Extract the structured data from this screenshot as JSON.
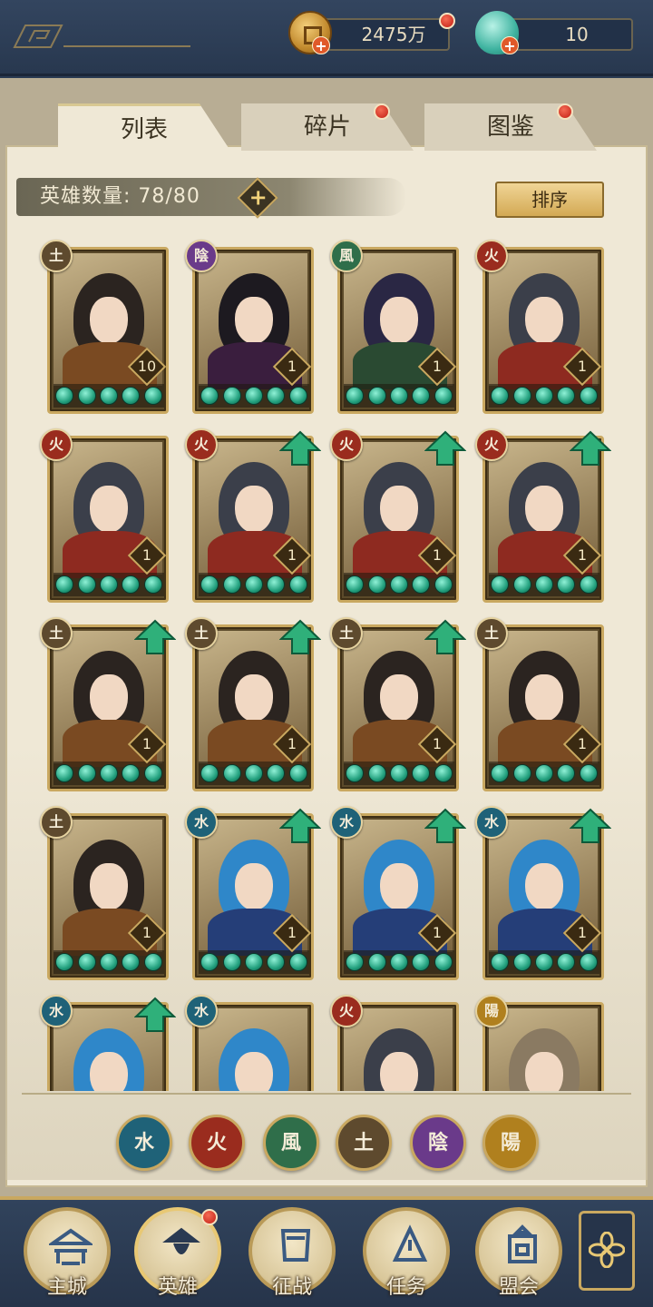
{
  "resources": {
    "coin_value": "2475万",
    "gem_value": "10"
  },
  "tabs": [
    {
      "label": "列表",
      "active": true
    },
    {
      "label": "碎片",
      "active": false
    },
    {
      "label": "图鉴",
      "active": false
    }
  ],
  "hero_count": {
    "label": "英雄数量:",
    "value": "78/80"
  },
  "sort_label": "排序",
  "elements": {
    "earth": "土",
    "yin": "陰",
    "wind": "風",
    "fire": "火",
    "water": "水",
    "yang": "陽"
  },
  "heroes": [
    {
      "element": "earth",
      "level": "10",
      "stars": 5,
      "upgradable": false
    },
    {
      "element": "yin",
      "level": "1",
      "stars": 5,
      "upgradable": false
    },
    {
      "element": "wind",
      "level": "1",
      "stars": 5,
      "upgradable": false
    },
    {
      "element": "fire",
      "level": "1",
      "stars": 5,
      "upgradable": false
    },
    {
      "element": "fire",
      "level": "1",
      "stars": 5,
      "upgradable": false
    },
    {
      "element": "fire",
      "level": "1",
      "stars": 5,
      "upgradable": true
    },
    {
      "element": "fire",
      "level": "1",
      "stars": 5,
      "upgradable": true
    },
    {
      "element": "fire",
      "level": "1",
      "stars": 5,
      "upgradable": true
    },
    {
      "element": "earth",
      "level": "1",
      "stars": 5,
      "upgradable": true
    },
    {
      "element": "earth",
      "level": "1",
      "stars": 5,
      "upgradable": true
    },
    {
      "element": "earth",
      "level": "1",
      "stars": 5,
      "upgradable": true
    },
    {
      "element": "earth",
      "level": "1",
      "stars": 5,
      "upgradable": false
    },
    {
      "element": "earth",
      "level": "1",
      "stars": 5,
      "upgradable": false
    },
    {
      "element": "water",
      "level": "1",
      "stars": 5,
      "upgradable": true
    },
    {
      "element": "water",
      "level": "1",
      "stars": 5,
      "upgradable": true
    },
    {
      "element": "water",
      "level": "1",
      "stars": 5,
      "upgradable": true
    },
    {
      "element": "water",
      "level": "",
      "stars": 0,
      "upgradable": true
    },
    {
      "element": "water",
      "level": "",
      "stars": 0,
      "upgradable": false
    },
    {
      "element": "fire",
      "level": "",
      "stars": 0,
      "upgradable": false
    },
    {
      "element": "yang",
      "level": "",
      "stars": 0,
      "upgradable": false
    }
  ],
  "filters": [
    {
      "element": "water",
      "label": "水"
    },
    {
      "element": "fire",
      "label": "火"
    },
    {
      "element": "wind",
      "label": "風"
    },
    {
      "element": "earth",
      "label": "土"
    },
    {
      "element": "yin",
      "label": "陰"
    },
    {
      "element": "yang",
      "label": "陽"
    }
  ],
  "nav": [
    {
      "label": "主城",
      "icon": "city-icon",
      "active": false
    },
    {
      "label": "英雄",
      "icon": "hero-icon",
      "active": true
    },
    {
      "label": "征战",
      "icon": "battle-icon",
      "active": false
    },
    {
      "label": "任务",
      "icon": "quest-icon",
      "active": false
    },
    {
      "label": "盟会",
      "icon": "guild-icon",
      "active": false
    }
  ],
  "colors": {
    "frame": "#2a3a52",
    "paper": "#efe8d6",
    "gold": "#c9a860",
    "notify": "#c21f14",
    "star": "#23a07e"
  }
}
